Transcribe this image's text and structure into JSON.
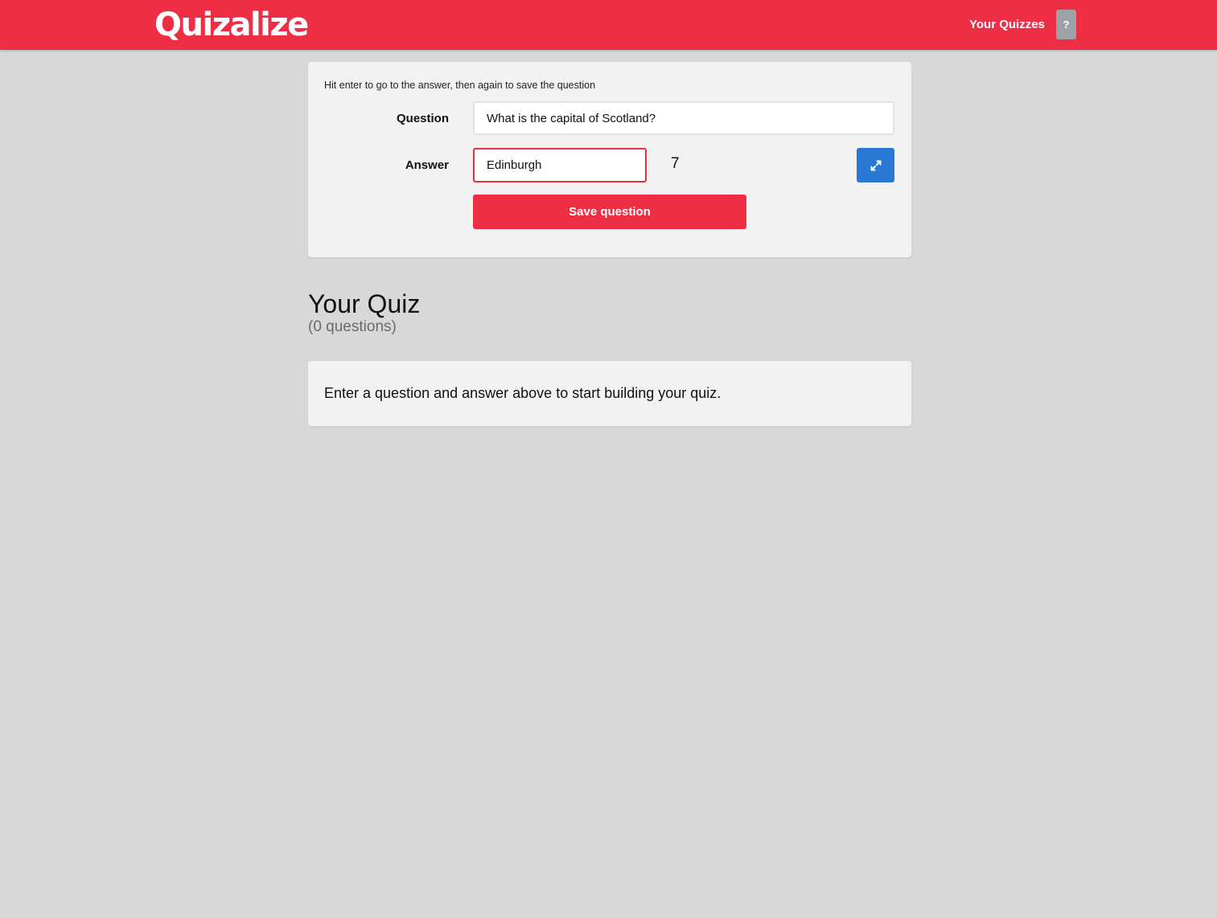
{
  "header": {
    "logo_text": "Quizalize",
    "nav_your_quizzes": "Your Quizzes",
    "help_label": "?",
    "brand_color": "#ee2e45"
  },
  "editor": {
    "hint": "Hit enter to go to the answer, then again to save the question",
    "question_label": "Question",
    "question_value": "What is the capital of Scotland?",
    "answer_label": "Answer",
    "answer_value": "Edinburgh",
    "answer_char_count": "7",
    "expand_icon": "expand-icon",
    "expand_color": "#2979d4",
    "save_label": "Save question"
  },
  "quiz": {
    "title": "Your Quiz",
    "count": "(0 questions)",
    "empty_message": "Enter a question and answer above to start building your quiz."
  }
}
